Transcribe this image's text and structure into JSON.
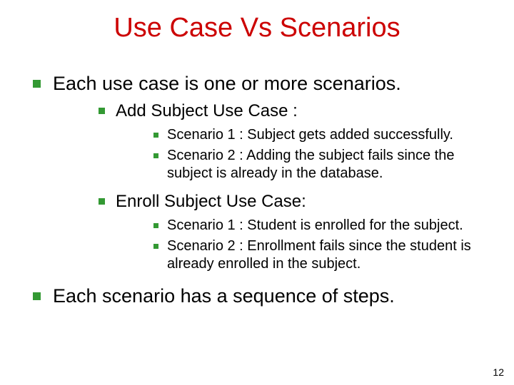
{
  "title": "Use Case Vs Scenarios",
  "bullets": {
    "top1": "Each use case is one or more scenarios.",
    "sub1": {
      "heading": "Add Subject Use Case :",
      "items": [
        "Scenario 1 : Subject gets added successfully.",
        "Scenario 2 : Adding the subject fails since the subject is already in the database."
      ]
    },
    "sub2": {
      "heading": "Enroll  Subject Use Case:",
      "items": [
        "Scenario 1 : Student is enrolled for the subject.",
        "Scenario 2 : Enrollment fails since the student is already enrolled in the subject."
      ]
    },
    "top2": "Each scenario has a sequence of steps."
  },
  "page_number": "12"
}
